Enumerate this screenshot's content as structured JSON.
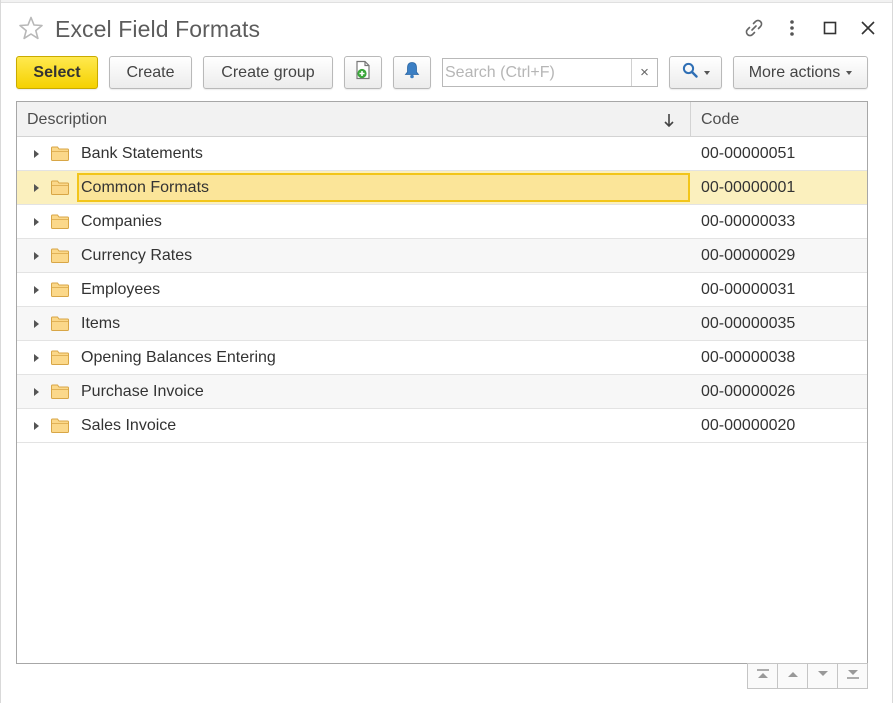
{
  "window": {
    "title": "Excel Field Formats",
    "icons": [
      "star-icon",
      "link-icon",
      "more-vertical-icon",
      "maximize-icon",
      "close-icon"
    ]
  },
  "toolbar": {
    "select_label": "Select",
    "create_label": "Create",
    "create_group_label": "Create group",
    "add_document_icon": "add-document-icon",
    "bell_icon": "bell-icon",
    "search_placeholder": "Search (Ctrl+F)",
    "search_value": "",
    "clear_label": "×",
    "search_icon": "search-icon",
    "more_actions_label": "More actions"
  },
  "grid": {
    "columns": [
      "Description",
      "Code"
    ],
    "sort": {
      "column": "Description",
      "direction": "descending-arrow"
    },
    "rows": [
      {
        "description": "Bank Statements",
        "code": "00-00000051",
        "selected": false
      },
      {
        "description": "Common Formats",
        "code": "00-00000001",
        "selected": true
      },
      {
        "description": "Companies",
        "code": "00-00000033",
        "selected": false
      },
      {
        "description": "Currency Rates",
        "code": "00-00000029",
        "selected": false
      },
      {
        "description": "Employees",
        "code": "00-00000031",
        "selected": false
      },
      {
        "description": "Items",
        "code": "00-00000035",
        "selected": false
      },
      {
        "description": "Opening Balances Entering",
        "code": "00-00000038",
        "selected": false
      },
      {
        "description": "Purchase Invoice",
        "code": "00-00000026",
        "selected": false
      },
      {
        "description": "Sales Invoice",
        "code": "00-00000020",
        "selected": false
      }
    ]
  },
  "navigation": [
    "first-page-icon",
    "previous-page-icon",
    "next-page-icon",
    "last-page-icon"
  ],
  "colors": {
    "primary_button": "#f5d100",
    "selected_row": "#fbf0be",
    "selected_cell_border": "#f2c51a",
    "add_icon_green": "#3aa63a",
    "bell_icon_blue": "#3b7fc4",
    "search_icon_blue": "#2f6fb5"
  }
}
